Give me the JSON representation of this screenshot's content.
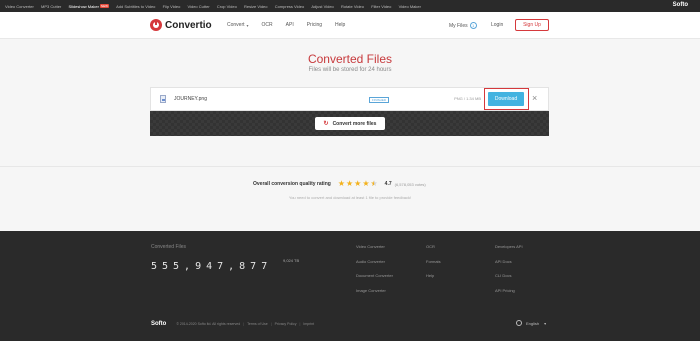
{
  "topbar": {
    "links": [
      {
        "label": "Video Converter"
      },
      {
        "label": "MP3 Cutter"
      },
      {
        "label": "Slideshow Maker",
        "badge": "NEW",
        "active": true
      },
      {
        "label": "Add Subtitles to Video"
      },
      {
        "label": "Flip Video"
      },
      {
        "label": "Video Cutter"
      },
      {
        "label": "Crop Video"
      },
      {
        "label": "Resize Video"
      },
      {
        "label": "Compress Video"
      },
      {
        "label": "Adjust Video"
      },
      {
        "label": "Rotate Video"
      },
      {
        "label": "Filter Video"
      },
      {
        "label": "Video Maker"
      }
    ],
    "brand": "Softo"
  },
  "header": {
    "logo_text": "Convertio",
    "nav": [
      {
        "label": "Convert",
        "has_dropdown": true
      },
      {
        "label": "OCR"
      },
      {
        "label": "API"
      },
      {
        "label": "Pricing"
      },
      {
        "label": "Help"
      }
    ],
    "my_files_label": "My Files",
    "my_files_count": "1",
    "login_label": "Login",
    "signup_label": "Sign Up"
  },
  "main": {
    "title": "Converted Files",
    "subtitle": "Files will be stored for 24 hours",
    "file": {
      "name": "JOURNEY.png",
      "status": "FINISHED",
      "meta": "PNG / 1.34 MB",
      "download_label": "Download",
      "close_icon": "×"
    },
    "convert_more_label": "Convert more files",
    "convert_more_icon": "↻"
  },
  "rating": {
    "label": "Overall conversion quality rating",
    "score": "4.7",
    "votes": "(6,578,053 votes)",
    "stars_filled": 4,
    "stars_half": 1,
    "note": "You need to convert and download at least 1 file to provide feedback!"
  },
  "footer": {
    "counter_label": "Converted Files",
    "counter_value": "555,947,877",
    "counter_unit": "9,024 TB",
    "col1": [
      {
        "label": "Video Converter"
      },
      {
        "label": "Audio Converter"
      },
      {
        "label": "Document Converter"
      },
      {
        "label": "Image Converter"
      }
    ],
    "col2": [
      {
        "label": "OCR"
      },
      {
        "label": "Formats"
      },
      {
        "label": "Help"
      }
    ],
    "col3": [
      {
        "label": "Developers API"
      },
      {
        "label": "API Docs"
      },
      {
        "label": "CLI Docs"
      },
      {
        "label": "API Pricing"
      }
    ],
    "logo": "Softo",
    "copyright": "© 2014-2020 Softo ltd. All rights reserved",
    "legal_links": [
      {
        "label": "Terms of Use"
      },
      {
        "label": "Privacy Policy"
      },
      {
        "label": "Imprint"
      }
    ],
    "language": "English"
  },
  "colors": {
    "accent": "#d5393c",
    "download": "#43b3e0",
    "star": "#f3b11b",
    "footer_bg": "#2a2a2a"
  }
}
